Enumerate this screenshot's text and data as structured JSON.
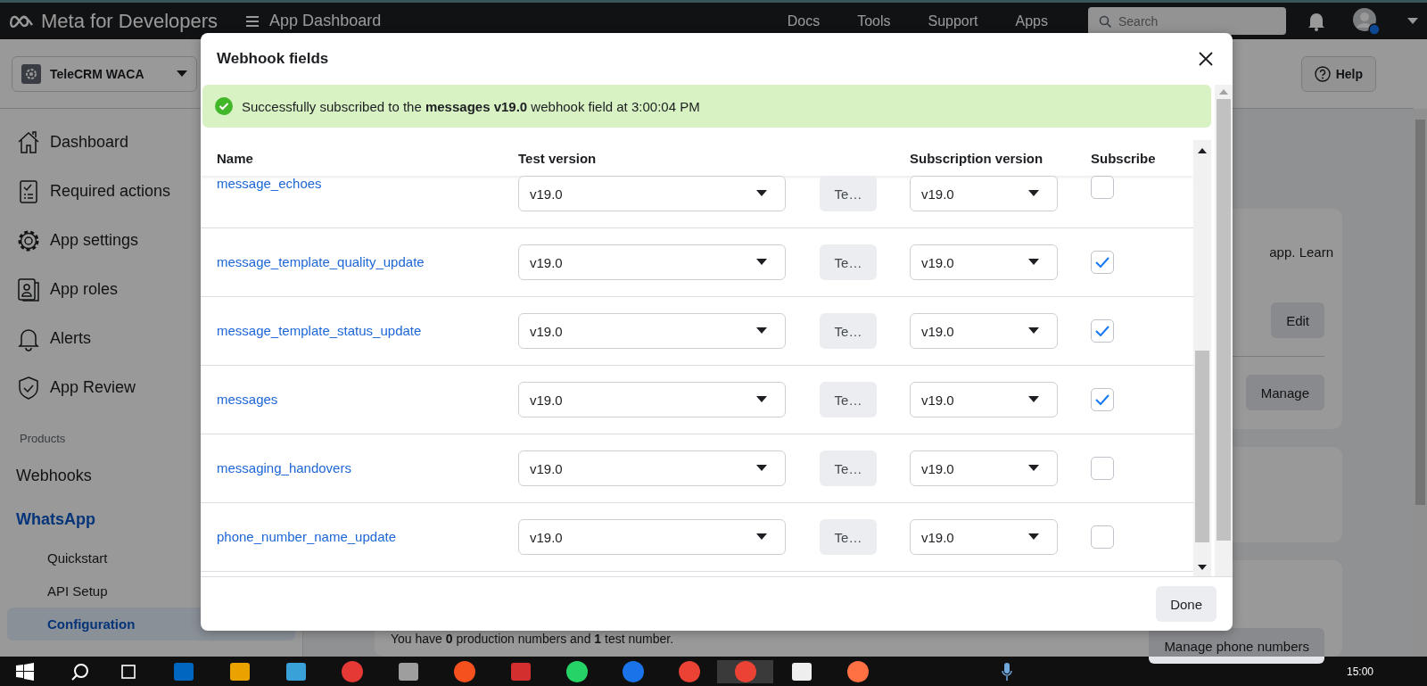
{
  "topbar": {
    "logo": "Meta for Developers",
    "menu_title": "App Dashboard",
    "links": [
      "Docs",
      "Tools",
      "Support",
      "Apps"
    ],
    "search": {
      "placeholder": "Search"
    }
  },
  "app_selector": {
    "name": "TeleCRM WACA"
  },
  "help_button": "Help",
  "sidebar": {
    "items": [
      {
        "label": "Dashboard"
      },
      {
        "label": "Required actions"
      },
      {
        "label": "App settings"
      },
      {
        "label": "App roles"
      },
      {
        "label": "Alerts"
      },
      {
        "label": "App Review"
      }
    ],
    "section_label": "Products",
    "products": [
      {
        "label": "Webhooks",
        "selected": false
      },
      {
        "label": "WhatsApp",
        "selected": true,
        "children": [
          {
            "label": "Quickstart",
            "selected": false
          },
          {
            "label": "API Setup",
            "selected": false
          },
          {
            "label": "Configuration",
            "selected": true
          }
        ]
      }
    ]
  },
  "main": {
    "card_text": "app. Learn",
    "edit_button": "Edit",
    "manage_button": "Manage",
    "numbers_text": "You have **0** production numbers and **1** test number.",
    "manage_numbers_button": "Manage phone numbers"
  },
  "modal": {
    "title": "Webhook fields",
    "banner": "Successfully subscribed to the **messages v19.0** webhook field at 3:00:04 PM",
    "columns": [
      "Name",
      "Test version",
      "Subscription version",
      "Subscribe"
    ],
    "rows": [
      {
        "name": "message_echoes",
        "test_version": "v19.0",
        "test_button": "Te…",
        "subscription_version": "v19.0",
        "subscribed": false
      },
      {
        "name": "message_template_quality_update",
        "test_version": "v19.0",
        "test_button": "Te…",
        "subscription_version": "v19.0",
        "subscribed": true
      },
      {
        "name": "message_template_status_update",
        "test_version": "v19.0",
        "test_button": "Te…",
        "subscription_version": "v19.0",
        "subscribed": true
      },
      {
        "name": "messages",
        "test_version": "v19.0",
        "test_button": "Te…",
        "subscription_version": "v19.0",
        "subscribed": true
      },
      {
        "name": "messaging_handovers",
        "test_version": "v19.0",
        "test_button": "Te…",
        "subscription_version": "v19.0",
        "subscribed": false
      },
      {
        "name": "phone_number_name_update",
        "test_version": "v19.0",
        "test_button": "Te…",
        "subscription_version": "v19.0",
        "subscribed": false
      }
    ],
    "done_button": "Done"
  },
  "taskbar": {
    "clock": "15:00"
  }
}
